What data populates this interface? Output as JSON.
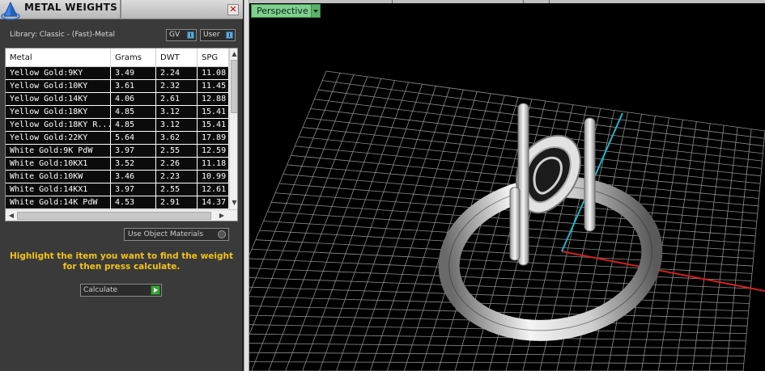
{
  "panel": {
    "title": "METAL WEIGHTS",
    "close_glyph": "✕",
    "library_label": "Library: Classic - (Fast)-Metal",
    "gv_select": "GV",
    "user_select": "User",
    "use_object_materials": "Use Object Materials",
    "hint_text": "Highlight the item you want to find the weight for then press calculate.",
    "calculate_label": "Calculate"
  },
  "table": {
    "columns": [
      "Metal",
      "Grams",
      "DWT",
      "SPG"
    ],
    "rows": [
      [
        "Yellow Gold:9KY",
        "3.49",
        "2.24",
        "11.08"
      ],
      [
        "Yellow Gold:10KY",
        "3.61",
        "2.32",
        "11.45"
      ],
      [
        "Yellow Gold:14KY",
        "4.06",
        "2.61",
        "12.88"
      ],
      [
        "Yellow Gold:18KY",
        "4.85",
        "3.12",
        "15.41"
      ],
      [
        "Yellow Gold:18KY R...",
        "4.85",
        "3.12",
        "15.41"
      ],
      [
        "Yellow Gold:22KY",
        "5.64",
        "3.62",
        "17.89"
      ],
      [
        "White Gold:9K PdW",
        "3.97",
        "2.55",
        "12.59"
      ],
      [
        "White Gold:10KX1",
        "3.52",
        "2.26",
        "11.18"
      ],
      [
        "White Gold:10KW",
        "3.46",
        "2.23",
        "10.99"
      ],
      [
        "White Gold:14KX1",
        "3.97",
        "2.55",
        "12.61"
      ],
      [
        "White Gold:14K PdW",
        "4.53",
        "2.91",
        "14.37"
      ]
    ]
  },
  "viewport": {
    "view_name": "Perspective"
  },
  "icons": {
    "app": "pyramid-app-icon",
    "dropdown": "chevron-down-icon",
    "go": "play-arrow-icon"
  },
  "colors": {
    "hint": "#f2c318",
    "view_tab": "#7fcf8f",
    "x_axis": "#d42020",
    "y_axis": "#1fb8c8"
  }
}
